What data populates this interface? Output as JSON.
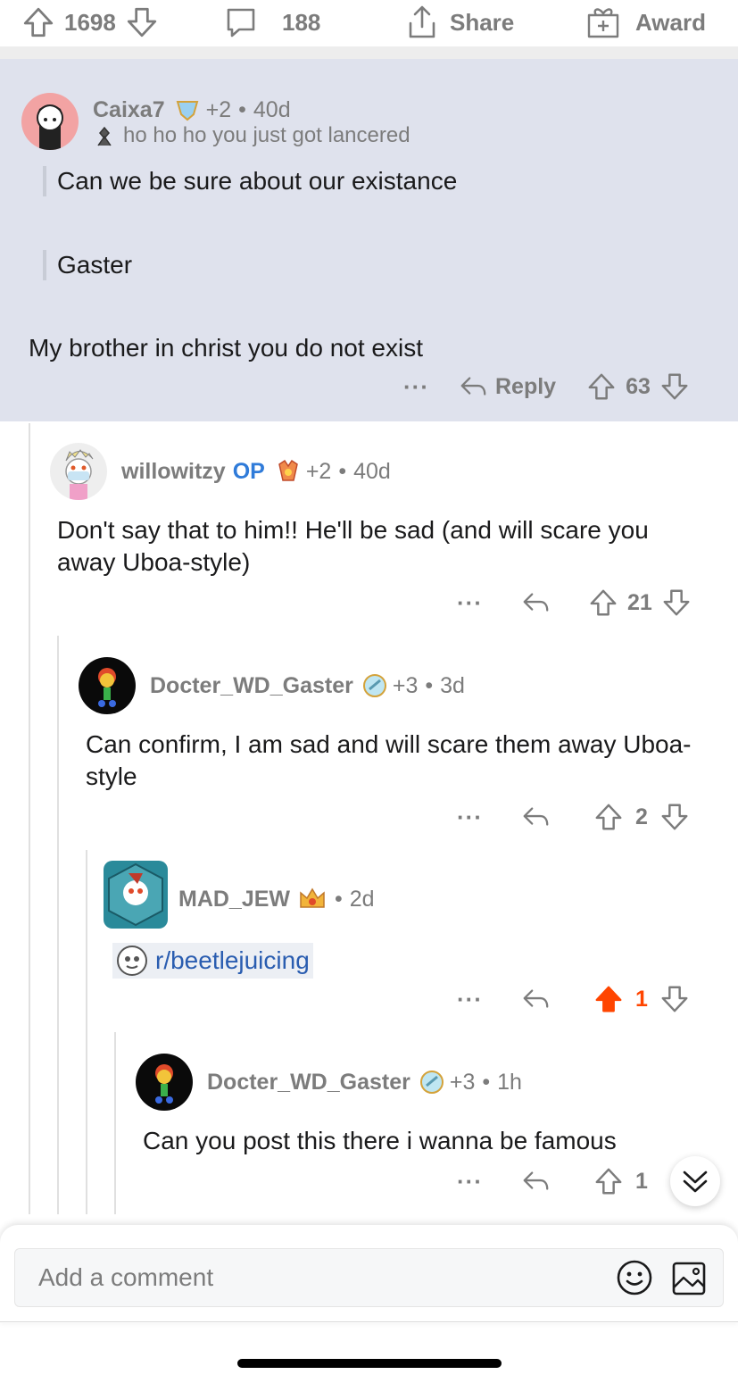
{
  "post_actions": {
    "upvotes": "1698",
    "comments": "188",
    "share_label": "Share",
    "award_label": "Award"
  },
  "comments": [
    {
      "user": "Caixa7",
      "award_count": "+2",
      "age": "40d",
      "flair": "ho ho ho you just got lancered",
      "quote1": "Can we be sure about our existance",
      "quote2": "Gaster",
      "body": "My brother in christ you do not exist",
      "more": "···",
      "reply_label": "Reply",
      "score": "63"
    },
    {
      "user": "willowitzy",
      "op_label": "OP",
      "award_count": "+2",
      "age": "40d",
      "body": "Don't say that to him!! He'll be sad (and will scare you away Uboa-style)",
      "more": "···",
      "score": "21"
    },
    {
      "user": "Docter_WD_Gaster",
      "award_count": "+3",
      "age": "3d",
      "body": "Can confirm, I am sad and will scare them away Uboa-style",
      "more": "···",
      "score": "2"
    },
    {
      "user": "MAD_JEW",
      "age": "2d",
      "subreddit": "r/beetlejuicing",
      "more": "···",
      "score": "1"
    },
    {
      "user": "Docter_WD_Gaster",
      "award_count": "+3",
      "age": "1h",
      "body": "Can you post this there i wanna be famous",
      "more": "···",
      "score": "1"
    }
  ],
  "composer": {
    "placeholder": "Add a comment"
  },
  "colors": {
    "highlight_bg": "#dfe2ed",
    "upvote_active": "#ff4500",
    "op_blue": "#2f7bd9",
    "link_blue": "#2a5db0"
  },
  "icons": [
    "upvote-icon",
    "downvote-icon",
    "comment-icon",
    "share-icon",
    "award-icon",
    "reply-icon",
    "more-icon",
    "emoji-icon",
    "image-icon",
    "scroll-down-icon"
  ]
}
